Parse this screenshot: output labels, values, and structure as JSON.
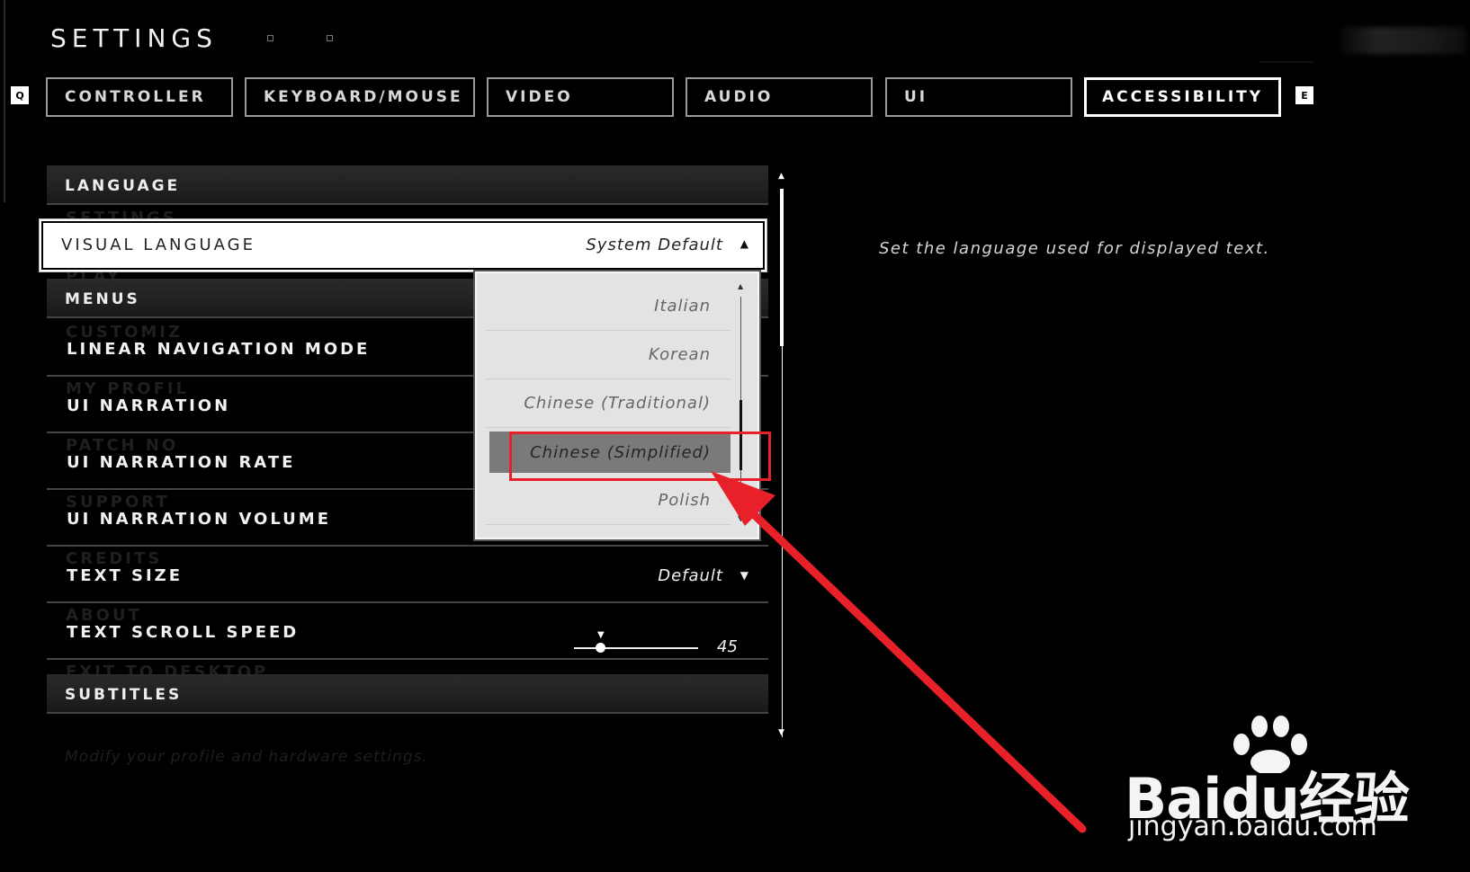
{
  "header": {
    "title": "SETTINGS"
  },
  "tabs": {
    "prev_key": "Q",
    "next_key": "E",
    "items": [
      {
        "label": "CONTROLLER"
      },
      {
        "label": "KEYBOARD/MOUSE"
      },
      {
        "label": "VIDEO"
      },
      {
        "label": "AUDIO"
      },
      {
        "label": "UI"
      },
      {
        "label": "ACCESSIBILITY",
        "active": true
      }
    ]
  },
  "background_menu": {
    "items": [
      "SETTINGS",
      "PLAY",
      "CUSTOMIZ",
      "MY PROFIL",
      "PATCH NO",
      "SUPPORT",
      "CREDITS",
      "ABOUT",
      "EXIT TO DESKTOP"
    ],
    "footer_hint": "Modify your profile and hardware settings."
  },
  "settings": {
    "language_section": "LANGUAGE",
    "visual_language": {
      "label": "VISUAL LANGUAGE",
      "value": "System Default"
    },
    "menus_section": "MENUS",
    "linear_navigation_mode": {
      "label": "LINEAR NAVIGATION MODE"
    },
    "ui_narration": {
      "label": "UI NARRATION"
    },
    "ui_narration_rate": {
      "label": "UI NARRATION RATE"
    },
    "ui_narration_volume": {
      "label": "UI NARRATION VOLUME"
    },
    "text_size": {
      "label": "TEXT SIZE",
      "value": "Default"
    },
    "text_scroll_speed": {
      "label": "TEXT SCROLL SPEED",
      "value": "45",
      "level": 45
    },
    "subtitles_section": "SUBTITLES"
  },
  "language_dropdown": {
    "options": [
      "Italian",
      "Korean",
      "Chinese (Traditional)",
      "Chinese (Simplified)",
      "Polish"
    ],
    "selected": "Chinese (Simplified)"
  },
  "description": "Set the language used for displayed text.",
  "annotation": {
    "color": "#e8202a"
  },
  "watermark": {
    "brand": "Baidu经验",
    "url": "jingyan.baidu.com"
  },
  "icons": {
    "caret_up": "▲",
    "caret_down": "▼",
    "scroll_up": "▲",
    "scroll_down": "▼"
  }
}
